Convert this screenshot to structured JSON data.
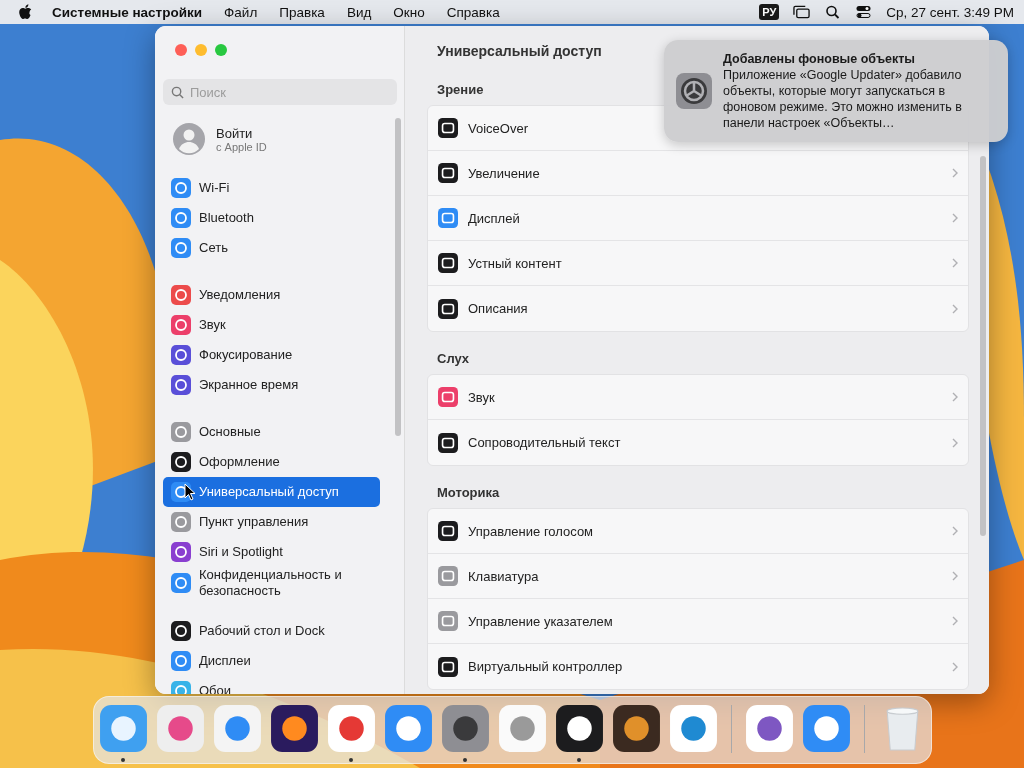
{
  "menu_bar": {
    "app_name": "Системные настройки",
    "menus": [
      "Файл",
      "Правка",
      "Вид",
      "Окно",
      "Справка"
    ],
    "input_source": "РУ",
    "clock": "Ср, 27 сент.  3:49 PM"
  },
  "window": {
    "search": {
      "placeholder": "Поиск"
    },
    "account": {
      "name": "Войти",
      "subtitle": "с Apple ID"
    },
    "sidebar": {
      "groups": [
        [
          {
            "label": "Wi-Fi",
            "color": "#2f8cf5",
            "selected": false
          },
          {
            "label": "Bluetooth",
            "color": "#2f8cf5",
            "selected": false
          },
          {
            "label": "Сеть",
            "color": "#2f8cf5",
            "selected": false
          }
        ],
        [
          {
            "label": "Уведомления",
            "color": "#ec4b4b",
            "selected": false
          },
          {
            "label": "Звук",
            "color": "#ec3f6a",
            "selected": false
          },
          {
            "label": "Фокусирование",
            "color": "#5a4fd8",
            "selected": false
          },
          {
            "label": "Экранное время",
            "color": "#5a4fd8",
            "selected": false
          }
        ],
        [
          {
            "label": "Основные",
            "color": "#9a9a9e",
            "selected": false
          },
          {
            "label": "Оформление",
            "color": "#1c1c1e",
            "selected": false
          },
          {
            "label": "Универсальный доступ",
            "color": "#2f8cf5",
            "selected": true
          },
          {
            "label": "Пункт управления",
            "color": "#9a9a9e",
            "selected": false
          },
          {
            "label": "Siri и Spotlight",
            "color": "#8a3fd0",
            "selected": false
          },
          {
            "label": "Конфиденциальность и безопасность",
            "color": "#2f8cf5",
            "selected": false
          }
        ],
        [
          {
            "label": "Рабочий стол и Dock",
            "color": "#1c1c1e",
            "selected": false
          },
          {
            "label": "Дисплеи",
            "color": "#2f8cf5",
            "selected": false
          },
          {
            "label": "Обои",
            "color": "#38b3e8",
            "selected": false
          }
        ]
      ]
    },
    "title": "Универсальный доступ",
    "sections": [
      {
        "heading": "Зрение",
        "rows": [
          {
            "label": "VoiceOver",
            "color": "#1c1c1e"
          },
          {
            "label": "Увеличение",
            "color": "#1c1c1e"
          },
          {
            "label": "Дисплей",
            "color": "#2f8cf5"
          },
          {
            "label": "Устный контент",
            "color": "#1c1c1e"
          },
          {
            "label": "Описания",
            "color": "#1c1c1e"
          }
        ]
      },
      {
        "heading": "Слух",
        "rows": [
          {
            "label": "Звук",
            "color": "#ec3f6a"
          },
          {
            "label": "Сопроводительный текст",
            "color": "#1c1c1e"
          }
        ]
      },
      {
        "heading": "Моторика",
        "rows": [
          {
            "label": "Управление голосом",
            "color": "#1c1c1e"
          },
          {
            "label": "Клавиатура",
            "color": "#9a9a9e"
          },
          {
            "label": "Управление указателем",
            "color": "#9a9a9e"
          },
          {
            "label": "Виртуальный контроллер",
            "color": "#1c1c1e"
          }
        ]
      }
    ]
  },
  "notification": {
    "title": "Добавлены фоновые объекты",
    "body": "Приложение «Google Updater» добавило объекты, которые могут запускаться в фоновом режиме. Это можно изменить в панели настроек «Объекты…"
  },
  "dock": {
    "items": [
      {
        "kind": "app",
        "running": true
      },
      {
        "kind": "app",
        "running": false
      },
      {
        "kind": "app",
        "running": false
      },
      {
        "kind": "app",
        "running": false
      },
      {
        "kind": "app",
        "running": true
      },
      {
        "kind": "app",
        "running": false
      },
      {
        "kind": "app",
        "running": true
      },
      {
        "kind": "app",
        "running": false
      },
      {
        "kind": "app",
        "running": true
      },
      {
        "kind": "app",
        "running": false
      },
      {
        "kind": "app",
        "running": false
      },
      {
        "kind": "separator"
      },
      {
        "kind": "app",
        "running": false
      },
      {
        "kind": "app",
        "running": false
      },
      {
        "kind": "separator"
      },
      {
        "kind": "trash"
      }
    ]
  }
}
